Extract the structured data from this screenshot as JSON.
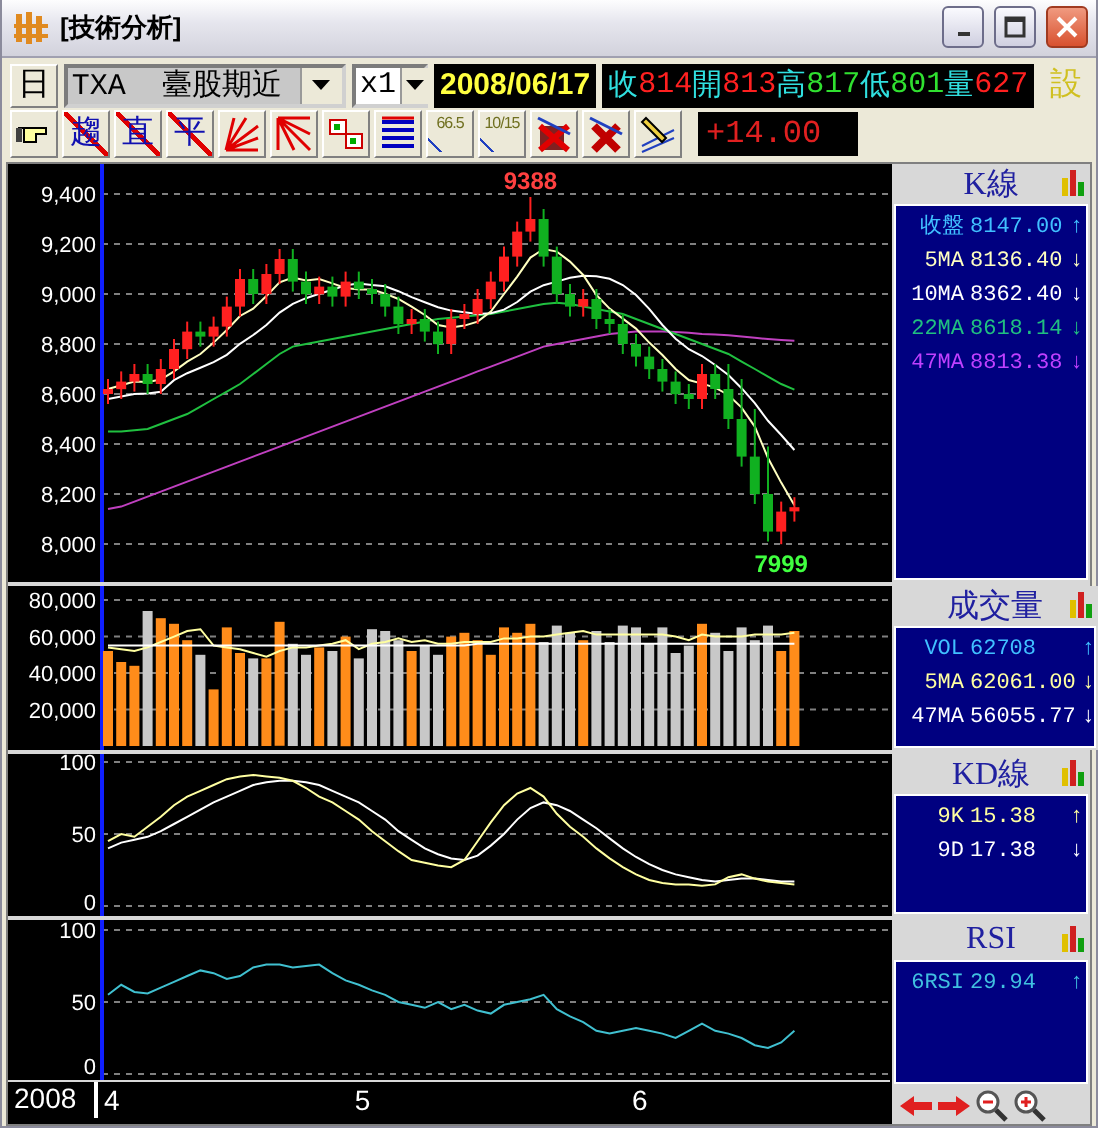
{
  "window": {
    "title": "[技術分析]"
  },
  "toolbar": {
    "period": "日",
    "symbol": "TXA  臺股期近",
    "multiplier": "x1",
    "date": "2008/06/17",
    "quote": [
      {
        "label": "收",
        "value": "814",
        "color": "#ff2020"
      },
      {
        "label": "開",
        "value": "813",
        "color": "#ff2020"
      },
      {
        "label": "高",
        "value": "817",
        "color": "#30e030"
      },
      {
        "label": "低",
        "value": "801",
        "color": "#30e030"
      },
      {
        "label": "量",
        "value": "627",
        "color": "#ff2020"
      }
    ],
    "settings": "設",
    "tools": [
      {
        "kind": "pointer"
      },
      {
        "kind": "glyph",
        "label": "趨"
      },
      {
        "kind": "glyph",
        "label": "直"
      },
      {
        "kind": "glyph",
        "label": "平"
      },
      {
        "kind": "fan"
      },
      {
        "kind": "fan2"
      },
      {
        "kind": "boxes"
      },
      {
        "kind": "lines"
      },
      {
        "kind": "fib",
        "label": "66.5"
      },
      {
        "kind": "fib",
        "label": "10/15"
      },
      {
        "kind": "erase"
      },
      {
        "kind": "delete"
      },
      {
        "kind": "pen"
      }
    ],
    "change": "+14.00"
  },
  "panels": [
    {
      "title": "K線",
      "readings": [
        {
          "label": "收盤",
          "value": "8147.00",
          "arrow": "↑",
          "color": "#40c0ff"
        },
        {
          "label": "5MA",
          "value": "8136.40",
          "arrow": "↓",
          "color": "#ffffc0"
        },
        {
          "label": "10MA",
          "value": "8362.40",
          "arrow": "↓",
          "color": "#ffffff"
        },
        {
          "label": "22MA",
          "value": "8618.14",
          "arrow": "↓",
          "color": "#20c080"
        },
        {
          "label": "47MA",
          "value": "8813.38",
          "arrow": "↓",
          "color": "#c040ff"
        }
      ],
      "chart_data": {
        "type": "candlestick",
        "grid": true,
        "ylim": [
          7990,
          9400
        ],
        "ohlc": [
          [
            8600,
            8660,
            8560,
            8620
          ],
          [
            8620,
            8690,
            8580,
            8650
          ],
          [
            8650,
            8720,
            8610,
            8680
          ],
          [
            8680,
            8720,
            8600,
            8640
          ],
          [
            8640,
            8740,
            8600,
            8700
          ],
          [
            8700,
            8820,
            8660,
            8780
          ],
          [
            8780,
            8890,
            8740,
            8850
          ],
          [
            8850,
            8890,
            8790,
            8830
          ],
          [
            8830,
            8910,
            8790,
            8870
          ],
          [
            8870,
            8990,
            8830,
            8950
          ],
          [
            8950,
            9100,
            8910,
            9060
          ],
          [
            9060,
            9100,
            8960,
            9000
          ],
          [
            9000,
            9120,
            8960,
            9080
          ],
          [
            9080,
            9180,
            9040,
            9140
          ],
          [
            9140,
            9180,
            9010,
            9050
          ],
          [
            9050,
            9090,
            8960,
            9000
          ],
          [
            9000,
            9070,
            8960,
            9030
          ],
          [
            9030,
            9070,
            8950,
            8990
          ],
          [
            8990,
            9090,
            8950,
            9050
          ],
          [
            9050,
            9090,
            8980,
            9020
          ],
          [
            9020,
            9060,
            8960,
            9000
          ],
          [
            9000,
            9040,
            8910,
            8950
          ],
          [
            8950,
            8990,
            8840,
            8880
          ],
          [
            8880,
            8940,
            8840,
            8900
          ],
          [
            8900,
            8940,
            8810,
            8850
          ],
          [
            8850,
            8890,
            8760,
            8800
          ],
          [
            8800,
            8940,
            8760,
            8900
          ],
          [
            8900,
            8960,
            8860,
            8920
          ],
          [
            8920,
            9020,
            8880,
            8980
          ],
          [
            8980,
            9090,
            8940,
            9050
          ],
          [
            9050,
            9190,
            9010,
            9150
          ],
          [
            9150,
            9290,
            9110,
            9250
          ],
          [
            9250,
            9388,
            9210,
            9300
          ],
          [
            9300,
            9340,
            9110,
            9150
          ],
          [
            9150,
            9190,
            8960,
            9000
          ],
          [
            9000,
            9040,
            8910,
            8950
          ],
          [
            8950,
            9020,
            8910,
            8980
          ],
          [
            8980,
            9020,
            8860,
            8900
          ],
          [
            8900,
            8940,
            8840,
            8880
          ],
          [
            8880,
            8920,
            8760,
            8800
          ],
          [
            8800,
            8840,
            8710,
            8750
          ],
          [
            8750,
            8790,
            8660,
            8700
          ],
          [
            8700,
            8740,
            8610,
            8650
          ],
          [
            8650,
            8690,
            8560,
            8600
          ],
          [
            8600,
            8640,
            8540,
            8580
          ],
          [
            8580,
            8720,
            8540,
            8680
          ],
          [
            8680,
            8720,
            8580,
            8620
          ],
          [
            8620,
            8720,
            8460,
            8500
          ],
          [
            8500,
            8660,
            8310,
            8350
          ],
          [
            8350,
            8540,
            8160,
            8200
          ],
          [
            8200,
            8390,
            8010,
            8050
          ],
          [
            8050,
            8170,
            7999,
            8130
          ],
          [
            8130,
            8187,
            8090,
            8147
          ]
        ],
        "yticks": [
          {
            "value": 8000,
            "label": "8,000"
          },
          {
            "value": 8200,
            "label": "8,200"
          },
          {
            "value": 8400,
            "label": "8,400"
          },
          {
            "value": 8600,
            "label": "8,600"
          },
          {
            "value": 8800,
            "label": "8,800"
          },
          {
            "value": 9000,
            "label": "9,000"
          },
          {
            "value": 9200,
            "label": "9,200"
          },
          {
            "value": 9400,
            "label": "9,400"
          }
        ],
        "series": [
          {
            "type": "line",
            "color": "#c040c0",
            "values": [
              8140,
              8150,
              8170,
              8190,
              8210,
              8230,
              8250,
              8270,
              8290,
              8310,
              8330,
              8350,
              8370,
              8390,
              8410,
              8430,
              8450,
              8470,
              8490,
              8510,
              8530,
              8550,
              8570,
              8590,
              8610,
              8630,
              8650,
              8670,
              8690,
              8710,
              8730,
              8750,
              8770,
              8790,
              8800,
              8810,
              8820,
              8830,
              8840,
              8845,
              8850,
              8850,
              8850,
              8848,
              8845,
              8840,
              8838,
              8835,
              8830,
              8825,
              8820,
              8816,
              8813
            ]
          },
          {
            "type": "line",
            "color": "#20c040",
            "values": [
              8450,
              8450,
              8455,
              8460,
              8480,
              8500,
              8520,
              8550,
              8580,
              8610,
              8640,
              8680,
              8720,
              8760,
              8790,
              8800,
              8810,
              8820,
              8830,
              8840,
              8850,
              8860,
              8870,
              8880,
              8890,
              8900,
              8905,
              8910,
              8915,
              8920,
              8930,
              8940,
              8950,
              8960,
              8965,
              8960,
              8950,
              8940,
              8930,
              8920,
              8900,
              8880,
              8860,
              8840,
              8820,
              8800,
              8780,
              8760,
              8730,
              8700,
              8670,
              8640,
              8618
            ]
          },
          {
            "type": "line",
            "color": "#ffffff",
            "values": [
              8580,
              8590,
              8600,
              8602,
              8609,
              8655,
              8683,
              8705,
              8727,
              8757,
              8801,
              8836,
              8876,
              8926,
              8961,
              8983,
              9001,
              9017,
              9035,
              9042,
              9036,
              9031,
              9011,
              8987,
              8967,
              8947,
              8934,
              8927,
              8920,
              8923,
              8938,
              8968,
              9010,
              9035,
              9050,
              9065,
              9073,
              9071,
              9061,
              9036,
              8996,
              8941,
              8876,
              8821,
              8779,
              8752,
              8716,
              8676,
              8623,
              8563,
              8493,
              8436,
              8376
            ]
          },
          {
            "type": "line",
            "color": "#ffffc0",
            "values": [
              8620,
              8635,
              8650,
              8648,
              8658,
              8690,
              8730,
              8760,
              8806,
              8856,
              8912,
              8942,
              8992,
              9046,
              9066,
              9054,
              9060,
              9042,
              9024,
              9018,
              9018,
              9002,
              8980,
              8950,
              8916,
              8876,
              8866,
              8874,
              8890,
              8930,
              9000,
              9070,
              9146,
              9180,
              9170,
              9130,
              9076,
              8996,
              8942,
              8902,
              8862,
              8806,
              8756,
              8700,
              8656,
              8642,
              8626,
              8596,
              8546,
              8470,
              8344,
              8246,
              8155
            ]
          }
        ],
        "annotations": [
          "9388",
          "7999"
        ]
      }
    },
    {
      "title": "成交量",
      "readings": [
        {
          "label": "VOL",
          "value": "62708",
          "arrow": "↑",
          "color": "#40c0ff"
        },
        {
          "label": "5MA",
          "value": "62061.00",
          "arrow": "↓",
          "color": "#ffffa0"
        },
        {
          "label": "47MA",
          "value": "56055.77",
          "arrow": "↓",
          "color": "#ffffff"
        }
      ],
      "chart_data": {
        "type": "bar",
        "grid": true,
        "ylim": [
          0,
          80000
        ],
        "yticks": [
          {
            "value": 20000,
            "label": "20,000"
          },
          {
            "value": 40000,
            "label": "40,000"
          },
          {
            "value": 60000,
            "label": "60,000"
          },
          {
            "value": 80000,
            "label": "80,000"
          }
        ],
        "series": [
          {
            "type": "bar",
            "colors": [
              "#ff8c1a",
              "#ff8c1a",
              "#ff8c1a",
              "#c8c8c8",
              "#ff8c1a",
              "#ff8c1a",
              "#ff8c1a",
              "#c8c8c8",
              "#ff8c1a",
              "#ff8c1a",
              "#ff8c1a",
              "#c8c8c8",
              "#ff8c1a",
              "#ff8c1a",
              "#c8c8c8",
              "#c8c8c8",
              "#ff8c1a",
              "#c8c8c8",
              "#ff8c1a",
              "#c8c8c8",
              "#c8c8c8",
              "#c8c8c8",
              "#c8c8c8",
              "#ff8c1a",
              "#c8c8c8",
              "#c8c8c8",
              "#ff8c1a",
              "#ff8c1a",
              "#ff8c1a",
              "#ff8c1a",
              "#ff8c1a",
              "#ff8c1a",
              "#ff8c1a",
              "#c8c8c8",
              "#c8c8c8",
              "#c8c8c8",
              "#ff8c1a",
              "#c8c8c8",
              "#c8c8c8",
              "#c8c8c8",
              "#c8c8c8",
              "#c8c8c8",
              "#c8c8c8",
              "#c8c8c8",
              "#c8c8c8",
              "#ff8c1a",
              "#c8c8c8",
              "#c8c8c8",
              "#c8c8c8",
              "#c8c8c8",
              "#c8c8c8",
              "#ff8c1a",
              "#ff8c1a"
            ],
            "values": [
              52000,
              46000,
              44000,
              74000,
              70000,
              67000,
              58000,
              50000,
              31000,
              65000,
              51000,
              48000,
              48000,
              68000,
              56000,
              50000,
              54000,
              52000,
              60000,
              48000,
              64000,
              63000,
              58000,
              52000,
              55000,
              50000,
              60000,
              62000,
              58000,
              50000,
              65000,
              62000,
              67000,
              57000,
              66000,
              62000,
              58000,
              63000,
              57000,
              66000,
              65000,
              56000,
              65000,
              51000,
              55000,
              67000,
              62000,
              52000,
              65000,
              58000,
              66000,
              52000,
              63000
            ]
          },
          {
            "type": "line",
            "color": "#ffffa0",
            "values": [
              54000,
              53000,
              52000,
              54000,
              57000,
              60000,
              63000,
              64000,
              55000,
              54000,
              53000,
              51000,
              49000,
              52000,
              54000,
              54000,
              55000,
              56000,
              58000,
              53000,
              56000,
              57000,
              59000,
              57000,
              58000,
              56000,
              56000,
              57000,
              57000,
              57000,
              59000,
              59000,
              60000,
              60000,
              61000,
              62000,
              63000,
              61000,
              61000,
              61000,
              61000,
              61000,
              61000,
              60000,
              58000,
              61000,
              60000,
              60000,
              60000,
              61000,
              61000,
              61000,
              62000
            ]
          },
          {
            "type": "line",
            "color": "#ffffff",
            "values": [
              55000,
              55000,
              55000,
              55000,
              55000,
              55000,
              55000,
              55000,
              55000,
              55000,
              55000,
              55000,
              55000,
              55000,
              55000,
              55000,
              55000,
              55000,
              55000,
              55000,
              55000,
              55000,
              55000,
              55000,
              55000,
              55000,
              55000,
              55000,
              56000,
              56000,
              56000,
              56000,
              56000,
              56000,
              56000,
              56000,
              56000,
              56000,
              56000,
              56000,
              56000,
              56000,
              56000,
              56000,
              56000,
              56000,
              56000,
              56000,
              56000,
              56000,
              56000,
              56000,
              56000
            ]
          }
        ]
      }
    },
    {
      "title": "KD線",
      "readings": [
        {
          "label": "9K",
          "value": "15.38",
          "arrow": "↑",
          "color": "#ffffa0"
        },
        {
          "label": "9D",
          "value": "17.38",
          "arrow": "↓",
          "color": "#ffffff"
        }
      ],
      "chart_data": {
        "type": "line",
        "grid": true,
        "ylim": [
          0,
          100
        ],
        "yticks": [
          0,
          50,
          100
        ],
        "series": [
          {
            "color": "#ffffff",
            "values": [
              40,
              44,
              46,
              48,
              52,
              57,
              62,
              67,
              72,
              76,
              80,
              84,
              86,
              87,
              87,
              86,
              84,
              80,
              76,
              72,
              66,
              60,
              52,
              46,
              40,
              36,
              33,
              32,
              35,
              42,
              50,
              60,
              68,
              72,
              70,
              66,
              60,
              54,
              47,
              40,
              34,
              29,
              25,
              22,
              20,
              18,
              17,
              18,
              19,
              19,
              18,
              17,
              17
            ]
          },
          {
            "color": "#ffffa0",
            "values": [
              45,
              50,
              48,
              55,
              62,
              70,
              76,
              80,
              84,
              88,
              90,
              91,
              90,
              89,
              87,
              82,
              76,
              72,
              66,
              60,
              52,
              45,
              38,
              32,
              30,
              28,
              27,
              32,
              45,
              58,
              70,
              78,
              82,
              76,
              64,
              55,
              48,
              40,
              33,
              27,
              22,
              18,
              16,
              15,
              15,
              14,
              15,
              20,
              22,
              19,
              17,
              16,
              15
            ]
          }
        ]
      }
    },
    {
      "title": "RSI",
      "readings": [
        {
          "label": "6RSI",
          "value": "29.94",
          "arrow": "↑",
          "color": "#40c0e0"
        }
      ],
      "chart_data": {
        "type": "line",
        "grid": true,
        "ylim": [
          0,
          100
        ],
        "yticks": [
          0,
          50,
          100
        ],
        "categories": [
          "4",
          null,
          null,
          null,
          null,
          null,
          null,
          null,
          null,
          null,
          null,
          null,
          null,
          null,
          null,
          null,
          null,
          null,
          null,
          "5",
          null,
          null,
          null,
          null,
          null,
          null,
          null,
          null,
          null,
          null,
          null,
          null,
          null,
          null,
          null,
          null,
          null,
          null,
          null,
          null,
          "6",
          null,
          null,
          null,
          null,
          null,
          null,
          null,
          null,
          null,
          null,
          null,
          null
        ],
        "series": [
          {
            "color": "#40c0d0",
            "values": [
              55,
              62,
              57,
              56,
              60,
              64,
              68,
              72,
              70,
              66,
              68,
              74,
              76,
              76,
              74,
              75,
              76,
              70,
              65,
              62,
              58,
              55,
              50,
              48,
              46,
              50,
              45,
              48,
              44,
              42,
              48,
              50,
              52,
              55,
              45,
              40,
              36,
              30,
              28,
              30,
              32,
              30,
              28,
              25,
              30,
              35,
              30,
              28,
              25,
              20,
              18,
              22,
              30
            ]
          }
        ]
      }
    }
  ],
  "time_axis": {
    "year": "2008"
  }
}
